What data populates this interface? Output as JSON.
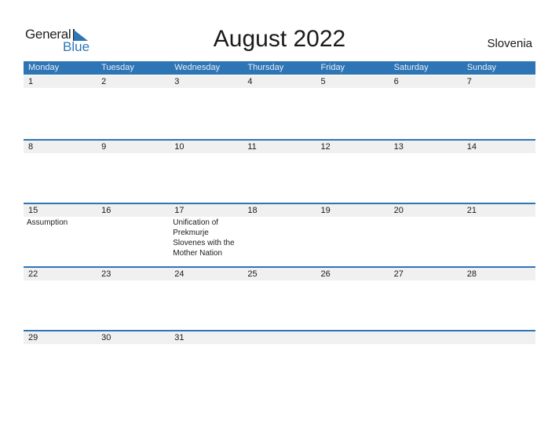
{
  "logo": {
    "general": "General",
    "blue": "Blue"
  },
  "title": "August 2022",
  "country": "Slovenia",
  "colors": {
    "accent": "#2e75b6",
    "dayBar": "#f0f0f0"
  },
  "weekdays": [
    "Monday",
    "Tuesday",
    "Wednesday",
    "Thursday",
    "Friday",
    "Saturday",
    "Sunday"
  ],
  "weeks": [
    {
      "days": [
        "1",
        "2",
        "3",
        "4",
        "5",
        "6",
        "7"
      ],
      "events": [
        "",
        "",
        "",
        "",
        "",
        "",
        ""
      ]
    },
    {
      "days": [
        "8",
        "9",
        "10",
        "11",
        "12",
        "13",
        "14"
      ],
      "events": [
        "",
        "",
        "",
        "",
        "",
        "",
        ""
      ]
    },
    {
      "days": [
        "15",
        "16",
        "17",
        "18",
        "19",
        "20",
        "21"
      ],
      "events": [
        "Assumption",
        "",
        "Unification of Prekmurje Slovenes with the Mother Nation",
        "",
        "",
        "",
        ""
      ]
    },
    {
      "days": [
        "22",
        "23",
        "24",
        "25",
        "26",
        "27",
        "28"
      ],
      "events": [
        "",
        "",
        "",
        "",
        "",
        "",
        ""
      ]
    },
    {
      "days": [
        "29",
        "30",
        "31",
        "",
        "",
        "",
        ""
      ],
      "events": [
        "",
        "",
        "",
        "",
        "",
        "",
        ""
      ]
    }
  ]
}
